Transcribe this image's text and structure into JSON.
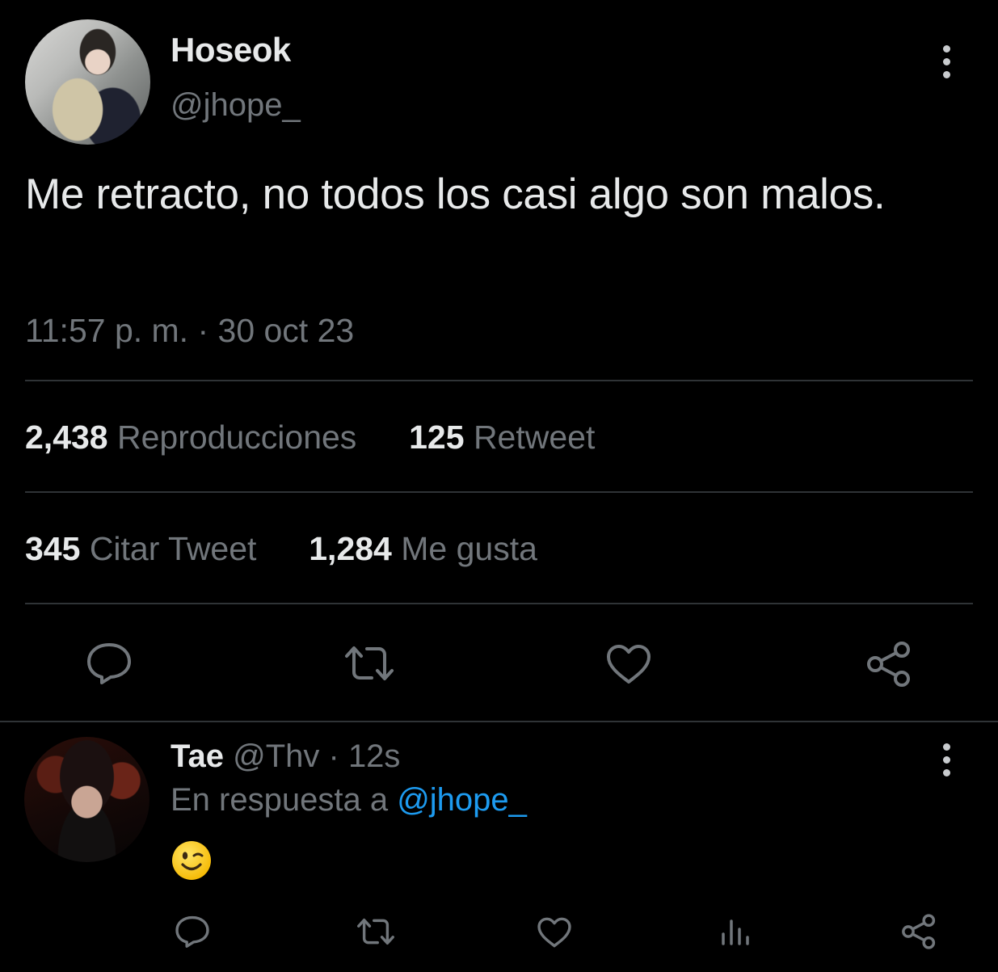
{
  "tweet": {
    "author_name": "Hoseok",
    "author_handle": "@jhope_",
    "text": "Me retracto, no todos los casi algo son malos.",
    "timestamp": "11:57 p. m. · 30 oct 23",
    "stats": {
      "views_count": "2,438",
      "views_label": "Reproducciones",
      "retweets_count": "125",
      "retweets_label": "Retweet",
      "quotes_count": "345",
      "quotes_label": "Citar Tweet",
      "likes_count": "1,284",
      "likes_label": "Me gusta"
    },
    "actions": [
      "reply-icon",
      "retweet-icon",
      "like-icon",
      "share-icon"
    ]
  },
  "reply": {
    "author_name": "Tae",
    "author_handle": "@Thv",
    "separator": " · ",
    "time_ago": "12s",
    "replying_prefix": "En respuesta a ",
    "replying_to": "@jhope_",
    "content_emoji": "winking-face-emoji",
    "actions": [
      "reply-icon",
      "retweet-icon",
      "like-icon",
      "views-icon",
      "share-icon"
    ]
  },
  "colors": {
    "background": "#000000",
    "text_primary": "#e7e9ea",
    "text_secondary": "#71767b",
    "divider": "#2f3336",
    "accent": "#1d9bf0"
  }
}
